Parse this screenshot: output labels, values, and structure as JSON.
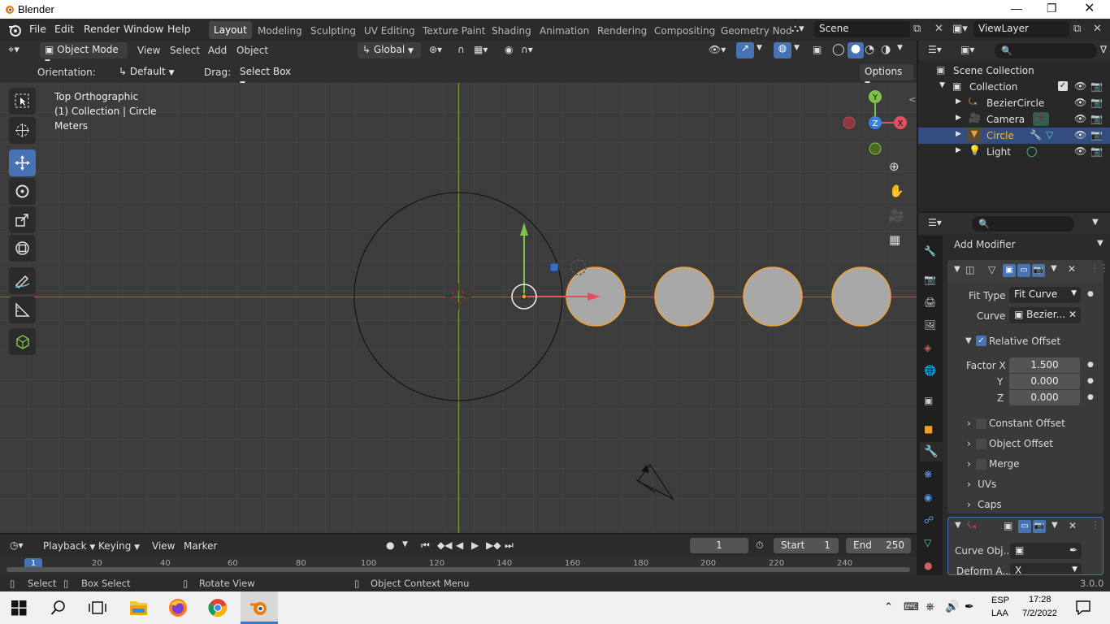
{
  "window": {
    "title": "Blender",
    "min_icon": "minimize-icon",
    "max_icon": "maximize-icon",
    "close_icon": "close-icon"
  },
  "menus": [
    "File",
    "Edit",
    "Render",
    "Window",
    "Help"
  ],
  "workspace_tabs": [
    "Layout",
    "Modeling",
    "Sculpting",
    "UV Editing",
    "Texture Paint",
    "Shading",
    "Animation",
    "Rendering",
    "Compositing",
    "Geometry Nod"
  ],
  "active_workspace": "Layout",
  "scene": "Scene",
  "view_layer": "ViewLayer",
  "viewport_header": {
    "mode": "Object Mode",
    "menus": [
      "View",
      "Select",
      "Add",
      "Object"
    ],
    "transform_orientation": "Global",
    "orientation_label": "Orientation:",
    "orientation_value": "Default",
    "drag_label": "Drag:",
    "drag_value": "Select Box",
    "options": "Options"
  },
  "viewport_overlay": {
    "line1": "Top Orthographic",
    "line2": "(1) Collection | Circle",
    "line3": "Meters"
  },
  "gizmo": {
    "y": "Y",
    "z": "Z",
    "x": "X"
  },
  "outliner": {
    "scene_collection": "Scene Collection",
    "collection": "Collection",
    "items": [
      "BezierCircle",
      "Camera",
      "Circle",
      "Light"
    ],
    "selected": "Circle"
  },
  "properties": {
    "add_modifier": "Add Modifier",
    "fit_type_label": "Fit Type",
    "fit_type_value": "Fit Curve",
    "curve_label": "Curve",
    "curve_value": "Bezier...",
    "relative_offset": "Relative Offset",
    "factor_x_label": "Factor X",
    "factor_x": "1.500",
    "y_label": "Y",
    "factor_y": "0.000",
    "z_label": "Z",
    "factor_z": "0.000",
    "sections": [
      "Constant Offset",
      "Object Offset",
      "Merge",
      "UVs",
      "Caps"
    ],
    "curve_object_label": "Curve Obj...",
    "deform_axis_label": "Deform A...",
    "deform_axis_value": "X"
  },
  "timeline": {
    "menus": [
      "Playback",
      "Keying",
      "View",
      "Marker"
    ],
    "current_frame": "1",
    "start_label": "Start",
    "start": "1",
    "end_label": "End",
    "end": "250",
    "ruler": [
      "1",
      "20",
      "40",
      "60",
      "80",
      "100",
      "120",
      "140",
      "160",
      "180",
      "200",
      "220",
      "240"
    ]
  },
  "statusbar": {
    "select": "Select",
    "box_select": "Box Select",
    "rotate_view": "Rotate View",
    "context_menu": "Object Context Menu",
    "version": "3.0.0"
  },
  "taskbar": {
    "lang1": "ESP",
    "lang2": "LAA",
    "time": "17:28",
    "date": "7/2/2022"
  },
  "colors": {
    "accent": "#4772b3",
    "selected_outline": "#f0a030",
    "x_axis": "#c8484f",
    "y_axis": "#7a9a2a"
  }
}
